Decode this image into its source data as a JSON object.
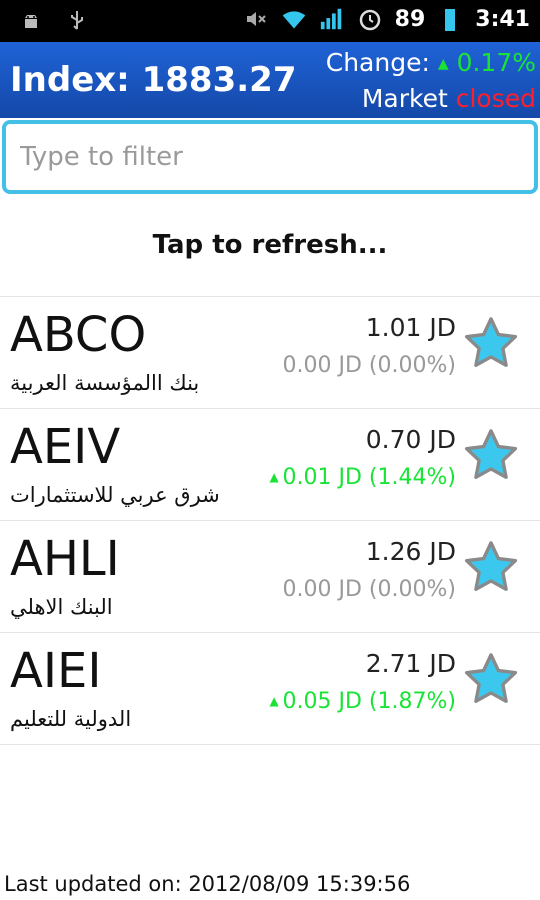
{
  "status_bar": {
    "battery": "89",
    "time": "3:41"
  },
  "header": {
    "index_text": "Index: 1883.27",
    "change_label": "Change:",
    "change_value": "0.17%",
    "market_label": "Market",
    "market_status": "closed"
  },
  "filter": {
    "placeholder": "Type to filter"
  },
  "refresh_label": "Tap to refresh...",
  "stocks": [
    {
      "symbol": "ABCO",
      "name": "بنك االمؤسسة العربية",
      "price": "1.01 JD",
      "change": "0.00 JD (0.00%)"
    },
    {
      "symbol": "AEIV",
      "name": "شرق عربي للاستثمارات",
      "price": "0.70 JD",
      "change": "0.01 JD (1.44%)"
    },
    {
      "symbol": "AHLI",
      "name": "البنك الاهلي",
      "price": "1.26 JD",
      "change": "0.00 JD (0.00%)"
    },
    {
      "symbol": "AIEI",
      "name": "الدولية للتعليم",
      "price": "2.71 JD",
      "change": "0.05 JD (1.87%)"
    }
  ],
  "last_updated": "Last updated on: 2012/08/09 15:39:56",
  "colors": {
    "accent_blue": "#1f63d7",
    "up_green": "#19e436",
    "closed_red": "#ff1f2c",
    "filter_border": "#44c0e6",
    "star_fill": "#3cc8ee"
  }
}
